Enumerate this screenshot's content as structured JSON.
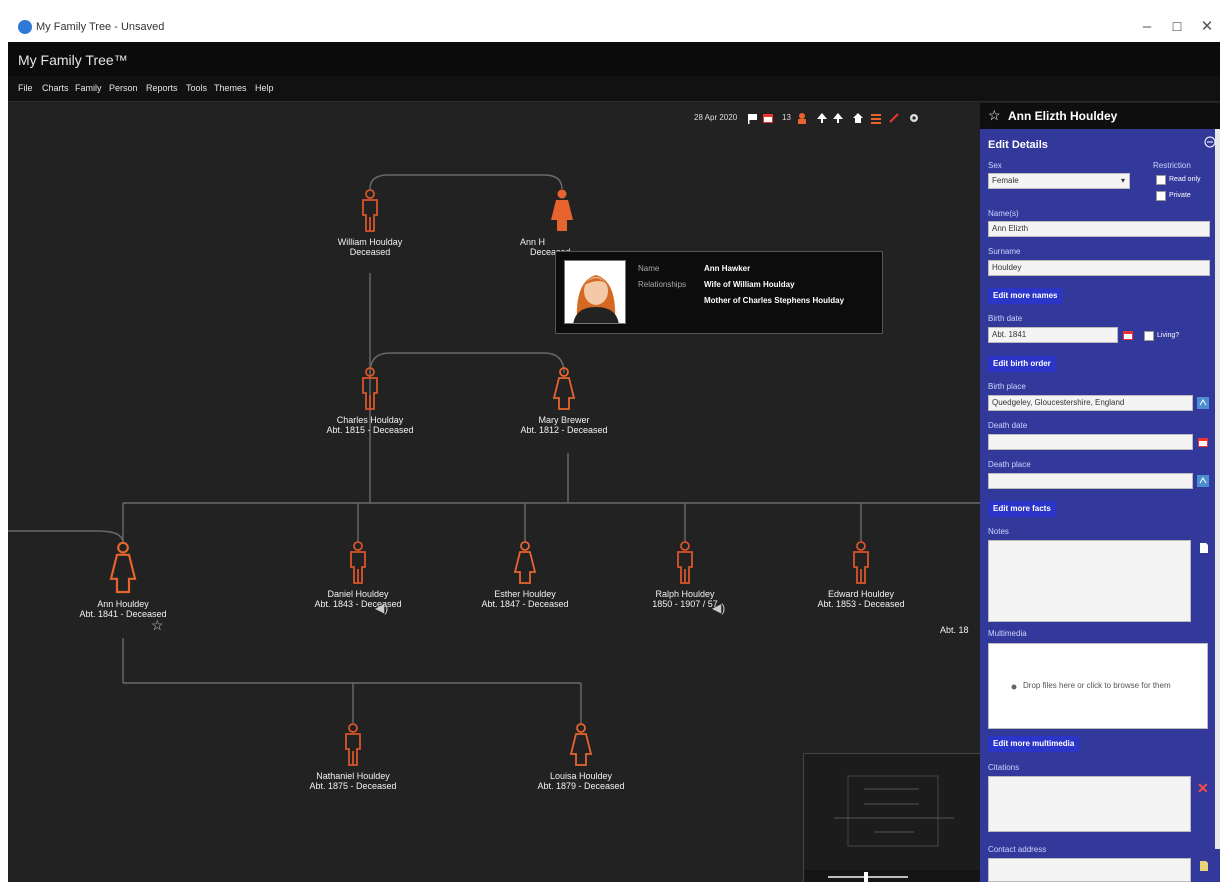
{
  "window": {
    "title": "My Family Tree - Unsaved",
    "minimize": "–",
    "maximize": "☐",
    "close": "✕"
  },
  "app": {
    "title": "My Family Tree™"
  },
  "menu": [
    "File",
    "Charts",
    "Family",
    "Person",
    "Reports",
    "Tools",
    "Themes",
    "Help"
  ],
  "toolbar": {
    "date": "28 Apr 2020",
    "count": "13"
  },
  "people": {
    "william": {
      "name": "William Houlday",
      "dates": "Deceased"
    },
    "ann_h": {
      "name": "Ann Hawker",
      "dates": "Deceased",
      "visible_name": "Ann H"
    },
    "charles": {
      "name": "Charles Houlday",
      "dates": "Abt. 1815 - Deceased"
    },
    "mary": {
      "name": "Mary Brewer",
      "dates": "Abt. 1812 - Deceased"
    },
    "ann": {
      "name": "Ann Houldey",
      "dates": "Abt. 1841 - Deceased"
    },
    "daniel": {
      "name": "Daniel Houldey",
      "dates": "Abt. 1843 - Deceased"
    },
    "esther": {
      "name": "Esther Houldey",
      "dates": "Abt. 1847 - Deceased"
    },
    "ralph": {
      "name": "Ralph Houldey",
      "dates": "1850 - 1907 / 57"
    },
    "edward": {
      "name": "Edward Houldey",
      "dates": "Abt. 1853 - Deceased"
    },
    "partial": {
      "dates": "Abt. 18"
    },
    "nathaniel": {
      "name": "Nathaniel Houldey",
      "dates": "Abt. 1875 - Deceased"
    },
    "louisa": {
      "name": "Louisa Houldey",
      "dates": "Abt. 1879 - Deceased"
    }
  },
  "tooltip": {
    "name_label": "Name",
    "name_value": "Ann Hawker",
    "rel_label": "Relationships",
    "rel_1": "Wife of William Houlday",
    "rel_2": "Mother of Charles Stephens Houlday"
  },
  "panel": {
    "person_name": "Ann Elizth Houldey",
    "section": "Edit Details",
    "sex_label": "Sex",
    "sex_value": "Female",
    "restriction_label": "Restriction",
    "read_only": "Read only",
    "private": "Private",
    "names_label": "Name(s)",
    "names_value": "Ann Elizth",
    "surname_label": "Surname",
    "surname_value": "Houldey",
    "edit_names": "Edit more names",
    "birth_date_label": "Birth date",
    "birth_date_value": "Abt. 1841",
    "living": "Living?",
    "edit_birth_order": "Edit birth order",
    "birth_place_label": "Birth place",
    "birth_place_value": "Quedgeley, Gloucestershire, England",
    "death_date_label": "Death date",
    "death_place_label": "Death place",
    "edit_facts": "Edit more facts",
    "notes_label": "Notes",
    "multimedia_label": "Multimedia",
    "drop_text": "Drop files here or click to browse for them",
    "edit_multimedia": "Edit more multimedia",
    "citations_label": "Citations",
    "contact_label": "Contact address"
  },
  "colors": {
    "male": "#d8552a",
    "female": "#e8642f",
    "accent": "#2b35c8",
    "panel": "#33399a"
  }
}
